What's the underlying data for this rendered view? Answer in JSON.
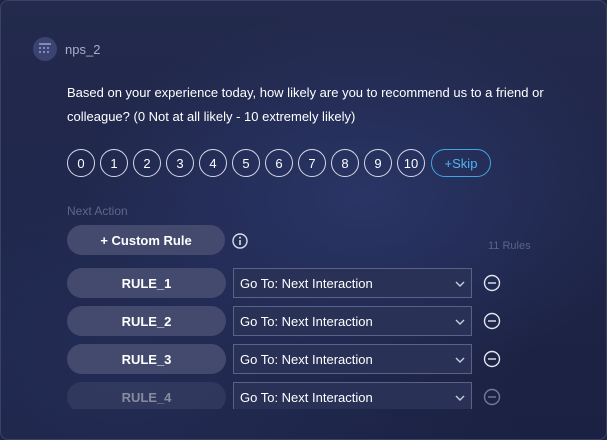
{
  "header": {
    "title": "nps_2",
    "icon": "list-grid-icon"
  },
  "question": {
    "text": "Based on your experience today, how likely are you to recommend us to a friend or colleague? (0 Not at all likely - 10 extremely likely)"
  },
  "scale": {
    "options": [
      "0",
      "1",
      "2",
      "3",
      "4",
      "5",
      "6",
      "7",
      "8",
      "9",
      "10"
    ],
    "skip_label": "+Skip"
  },
  "next_action": {
    "label": "Next Action",
    "custom_rule_label": "+ Custom Rule",
    "info_icon": "info-icon",
    "rules_count": "11 Rules"
  },
  "rules": [
    {
      "name": "RULE_1",
      "action": "Go To: Next Interaction"
    },
    {
      "name": "RULE_2",
      "action": "Go To: Next Interaction"
    },
    {
      "name": "RULE_3",
      "action": "Go To: Next Interaction"
    },
    {
      "name": "RULE_4",
      "action": "Go To: Next Interaction"
    }
  ],
  "colors": {
    "background": "#1e2544",
    "accent": "#4fb6ee",
    "pill": "#434a6e"
  }
}
